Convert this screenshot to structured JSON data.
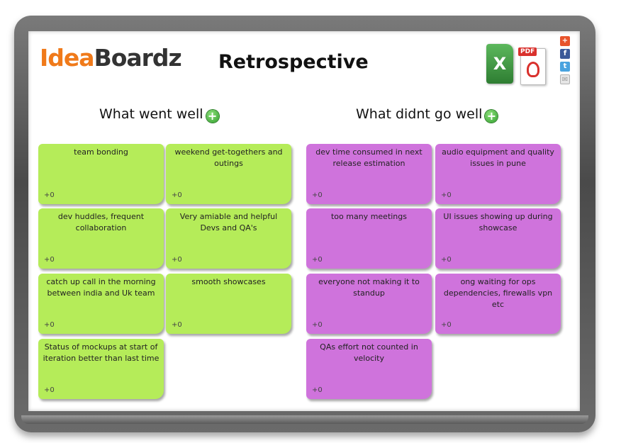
{
  "brand": {
    "logo_part1": "Idea",
    "logo_part2": "Boardz"
  },
  "page": {
    "title": "Retrospective"
  },
  "export": {
    "excel_label": "X",
    "pdf_label": "PDF"
  },
  "share": {
    "add": "+",
    "facebook": "f",
    "twitter": "t",
    "email": "✉"
  },
  "columns": {
    "well": {
      "title": "What went well",
      "notes": [
        {
          "text": "team bonding",
          "votes": "+0"
        },
        {
          "text": "weekend get-togethers and outings",
          "votes": "+0"
        },
        {
          "text": "dev huddles, frequent collaboration",
          "votes": "+0"
        },
        {
          "text": "Very amiable and helpful Devs and QA's",
          "votes": "+0"
        },
        {
          "text": "catch up call in the morning between india and Uk team",
          "votes": "+0"
        },
        {
          "text": "smooth showcases",
          "votes": "+0"
        },
        {
          "text": "Status of mockups at start of iteration better than last time",
          "votes": "+0"
        }
      ]
    },
    "not_well": {
      "title": "What didnt go well",
      "notes": [
        {
          "text": "dev time consumed in next release estimation",
          "votes": "+0"
        },
        {
          "text": "audio equipment and quality issues in pune",
          "votes": "+0"
        },
        {
          "text": "too many meetings",
          "votes": "+0"
        },
        {
          "text": "UI issues showing up during showcase",
          "votes": "+0"
        },
        {
          "text": "everyone not making it to standup",
          "votes": "+0"
        },
        {
          "text": "ong waiting for ops dependencies, firewalls vpn etc",
          "votes": "+0"
        },
        {
          "text": "QAs effort not counted in velocity",
          "votes": "+0"
        }
      ]
    }
  },
  "colors": {
    "well_note": "#b5ec59",
    "not_well_note": "#cf73dc",
    "logo_accent": "#f07a1a"
  }
}
